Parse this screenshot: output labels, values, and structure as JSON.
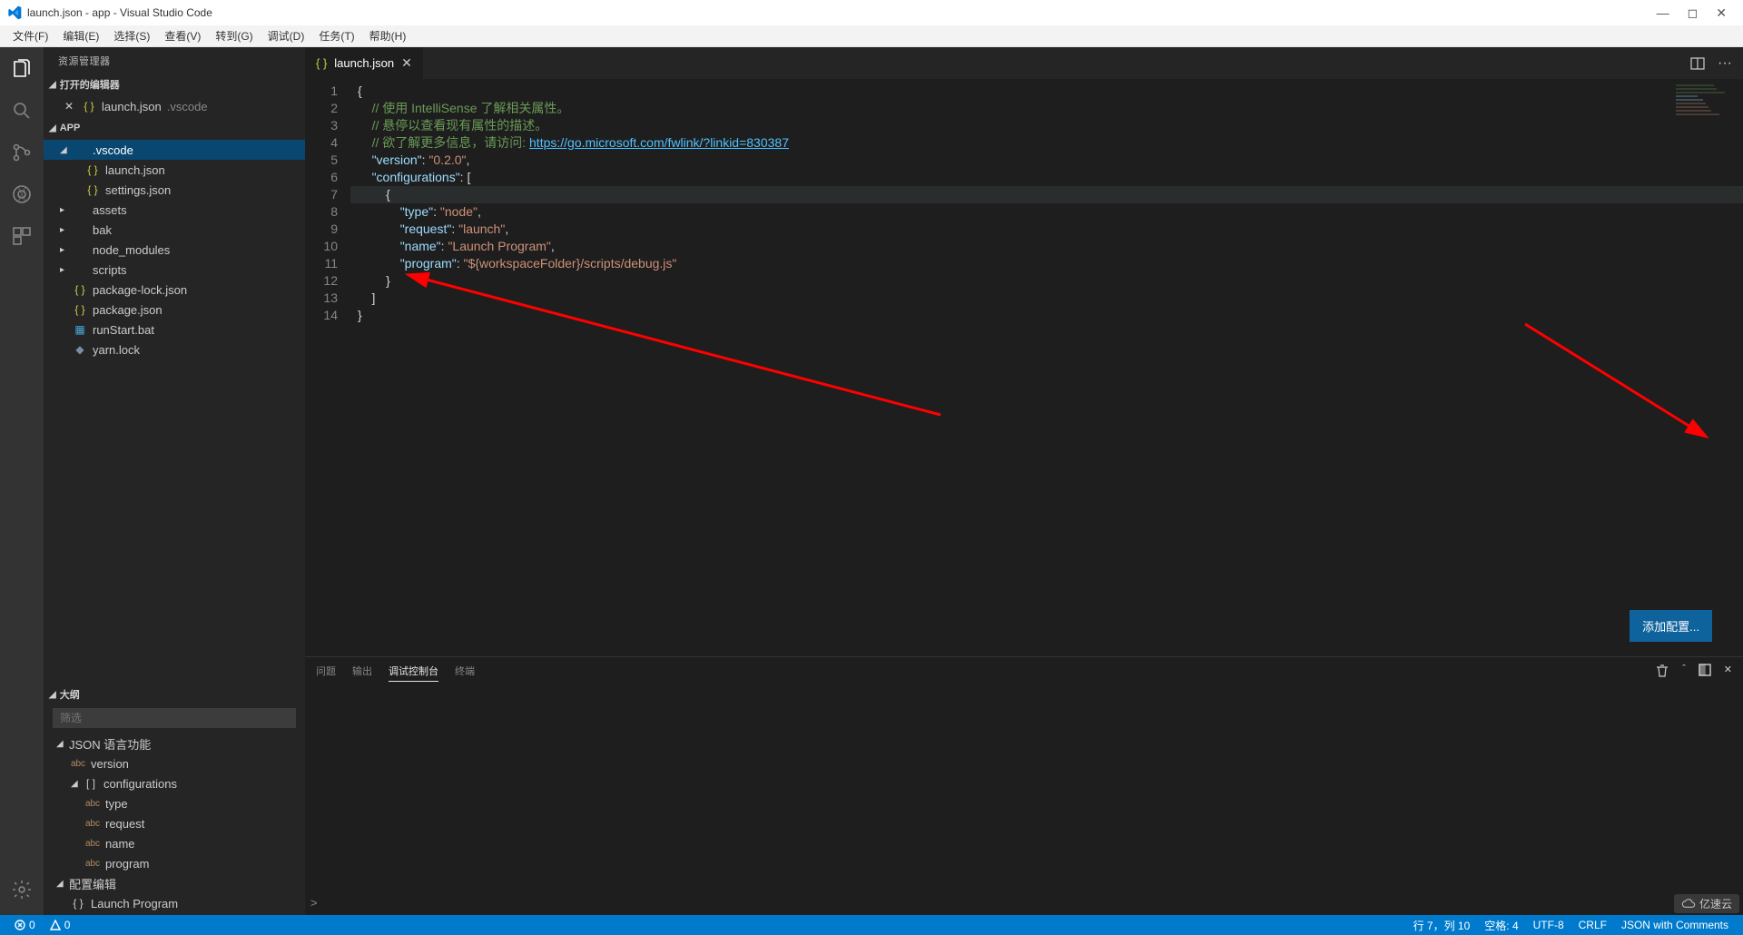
{
  "title": "launch.json - app - Visual Studio Code",
  "menu": [
    "文件(F)",
    "编辑(E)",
    "选择(S)",
    "查看(V)",
    "转到(G)",
    "调试(D)",
    "任务(T)",
    "帮助(H)"
  ],
  "sidebar": {
    "title": "资源管理器",
    "openEditors": {
      "label": "打开的编辑器",
      "items": [
        {
          "name": "launch.json",
          "path": ".vscode"
        }
      ]
    },
    "project": {
      "label": "APP",
      "tree": [
        {
          "kind": "folder",
          "name": ".vscode",
          "expanded": true,
          "selected": true,
          "depth": 0
        },
        {
          "kind": "json",
          "name": "launch.json",
          "depth": 1
        },
        {
          "kind": "json",
          "name": "settings.json",
          "depth": 1
        },
        {
          "kind": "folder",
          "name": "assets",
          "expanded": false,
          "depth": 0
        },
        {
          "kind": "folder",
          "name": "bak",
          "expanded": false,
          "depth": 0
        },
        {
          "kind": "folder",
          "name": "node_modules",
          "expanded": false,
          "depth": 0
        },
        {
          "kind": "folder",
          "name": "scripts",
          "expanded": false,
          "depth": 0
        },
        {
          "kind": "json",
          "name": "package-lock.json",
          "depth": 0
        },
        {
          "kind": "json",
          "name": "package.json",
          "depth": 0
        },
        {
          "kind": "bat",
          "name": "runStart.bat",
          "depth": 0
        },
        {
          "kind": "lock",
          "name": "yarn.lock",
          "depth": 0
        }
      ]
    },
    "outline": {
      "label": "大纲",
      "filterPlaceholder": "筛选",
      "items": [
        {
          "lvl": 0,
          "label": "JSON 语言功能",
          "exp": true,
          "icon": "chev"
        },
        {
          "lvl": 1,
          "label": "version",
          "icon": "abc"
        },
        {
          "lvl": 1,
          "label": "configurations",
          "exp": true,
          "icon": "array"
        },
        {
          "lvl": 2,
          "label": "type",
          "icon": "abc"
        },
        {
          "lvl": 2,
          "label": "request",
          "icon": "abc"
        },
        {
          "lvl": 2,
          "label": "name",
          "icon": "abc"
        },
        {
          "lvl": 2,
          "label": "program",
          "icon": "abc"
        },
        {
          "lvl": 0,
          "label": "配置编辑",
          "exp": true,
          "icon": "chev"
        },
        {
          "lvl": 1,
          "label": "Launch Program",
          "icon": "obj"
        }
      ]
    }
  },
  "tab": {
    "name": "launch.json"
  },
  "code": {
    "lines": [
      [
        {
          "c": "pln",
          "t": "{"
        }
      ],
      [
        {
          "c": "pln",
          "t": "    "
        },
        {
          "c": "cmt",
          "t": "// 使用 IntelliSense 了解相关属性。"
        }
      ],
      [
        {
          "c": "pln",
          "t": "    "
        },
        {
          "c": "cmt",
          "t": "// 悬停以查看现有属性的描述。"
        }
      ],
      [
        {
          "c": "pln",
          "t": "    "
        },
        {
          "c": "cmt",
          "t": "// 欲了解更多信息，请访问: "
        },
        {
          "c": "lnk",
          "t": "https://go.microsoft.com/fwlink/?linkid=830387"
        }
      ],
      [
        {
          "c": "pln",
          "t": "    "
        },
        {
          "c": "key",
          "t": "\"version\""
        },
        {
          "c": "pln",
          "t": ": "
        },
        {
          "c": "str",
          "t": "\"0.2.0\""
        },
        {
          "c": "pln",
          "t": ","
        }
      ],
      [
        {
          "c": "pln",
          "t": "    "
        },
        {
          "c": "key",
          "t": "\"configurations\""
        },
        {
          "c": "pln",
          "t": ": ["
        }
      ],
      [
        {
          "c": "pln",
          "t": "        {"
        }
      ],
      [
        {
          "c": "pln",
          "t": "            "
        },
        {
          "c": "key",
          "t": "\"type\""
        },
        {
          "c": "pln",
          "t": ": "
        },
        {
          "c": "str",
          "t": "\"node\""
        },
        {
          "c": "pln",
          "t": ","
        }
      ],
      [
        {
          "c": "pln",
          "t": "            "
        },
        {
          "c": "key",
          "t": "\"request\""
        },
        {
          "c": "pln",
          "t": ": "
        },
        {
          "c": "str",
          "t": "\"launch\""
        },
        {
          "c": "pln",
          "t": ","
        }
      ],
      [
        {
          "c": "pln",
          "t": "            "
        },
        {
          "c": "key",
          "t": "\"name\""
        },
        {
          "c": "pln",
          "t": ": "
        },
        {
          "c": "str",
          "t": "\"Launch Program\""
        },
        {
          "c": "pln",
          "t": ","
        }
      ],
      [
        {
          "c": "pln",
          "t": "            "
        },
        {
          "c": "key",
          "t": "\"program\""
        },
        {
          "c": "pln",
          "t": ": "
        },
        {
          "c": "str",
          "t": "\"${workspaceFolder}/scripts/debug.js\""
        }
      ],
      [
        {
          "c": "pln",
          "t": "        }"
        }
      ],
      [
        {
          "c": "pln",
          "t": "    ]"
        }
      ],
      [
        {
          "c": "pln",
          "t": "}"
        }
      ]
    ],
    "highlight": 7
  },
  "addConfig": "添加配置...",
  "panel": {
    "tabs": [
      "问题",
      "输出",
      "调试控制台",
      "终端"
    ],
    "active": 2,
    "prompt": ">"
  },
  "status": {
    "errors": "0",
    "warnings": "0",
    "cursor": "行 7，列 10",
    "spaces": "空格: 4",
    "encoding": "UTF-8",
    "eol": "CRLF",
    "lang": "JSON with Comments"
  },
  "watermark": "亿速云"
}
